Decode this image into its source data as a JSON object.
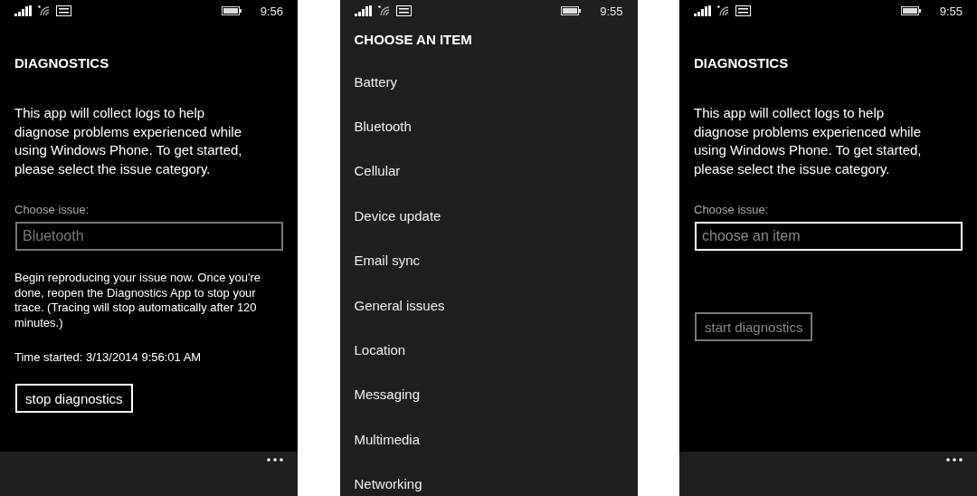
{
  "screens": [
    {
      "kind": "diagnostics",
      "status_bar": {
        "time": "9:56"
      },
      "title": "DIAGNOSTICS",
      "intro": "This app will collect logs to help diagnose problems experienced while using Windows Phone. To get started, please select the issue category.",
      "field_label": "Choose issue:",
      "field": {
        "value": "Bluetooth",
        "disabled": true
      },
      "message": "Begin reproducing your issue now. Once you're done, reopen the Diagnostics App to stop your trace. (Tracing will stop automatically after 120 minutes.)",
      "time_started": "Time started: 3/13/2014 9:56:01 AM",
      "button": {
        "label": "stop diagnostics",
        "disabled": false
      }
    },
    {
      "kind": "picker",
      "status_bar": {
        "time": "9:55"
      },
      "title": "CHOOSE AN ITEM",
      "items": [
        "Battery",
        "Bluetooth",
        "Cellular",
        "Device update",
        "Email sync",
        "General issues",
        "Location",
        "Messaging",
        "Multimedia",
        "Networking"
      ]
    },
    {
      "kind": "diagnostics",
      "status_bar": {
        "time": "9:55"
      },
      "title": "DIAGNOSTICS",
      "intro": "This app will collect logs to help diagnose problems experienced while using Windows Phone. To get started, please select the issue category.",
      "field_label": "Choose issue:",
      "field": {
        "placeholder": "choose an item",
        "disabled": false
      },
      "button": {
        "label": "start diagnostics",
        "disabled": true
      }
    }
  ]
}
